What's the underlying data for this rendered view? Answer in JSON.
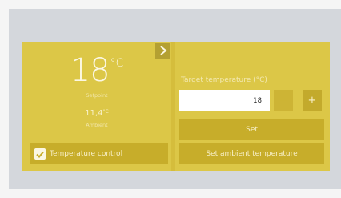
{
  "status": {
    "current_temp": "18",
    "temp_unit": "°C",
    "setpoint_caption": "Setpoint",
    "ambient_value": "11,4",
    "ambient_unit": "°C",
    "ambient_caption": "Ambient"
  },
  "control": {
    "toggle_label": "Temperature control",
    "toggle_checked": true
  },
  "target": {
    "title": "Target temperature (°C)",
    "input_value": "18",
    "decrement_label": "−",
    "increment_label": "+",
    "set_label": "Set",
    "set_ambient_label": "Set ambient temperature"
  },
  "theme": {
    "accent": "#d5bd3c",
    "panel": "#dcc747",
    "button": "#c7ad2a"
  }
}
